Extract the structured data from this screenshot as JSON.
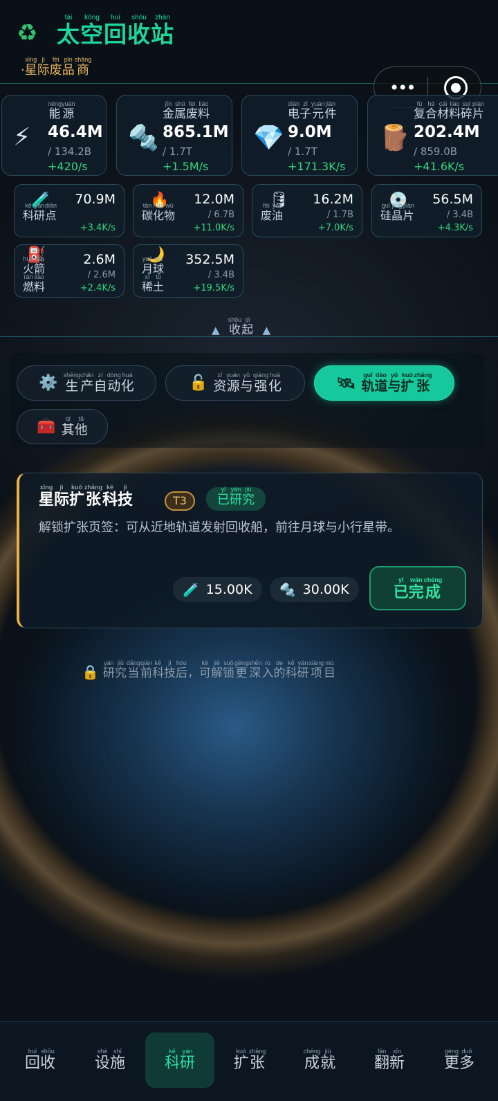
{
  "header": {
    "logo_icon": "recycle-icon",
    "title": [
      {
        "char": "太",
        "py": "tài"
      },
      {
        "char": "空",
        "py": "kōng"
      },
      {
        "char": "回",
        "py": "huí"
      },
      {
        "char": "收",
        "py": "shōu"
      },
      {
        "char": "站",
        "py": "zhàn"
      }
    ],
    "subtitle_prefix": "·",
    "subtitle": [
      {
        "char": "星",
        "py": "xīng"
      },
      {
        "char": "际",
        "py": "jì"
      },
      {
        "char": "废",
        "py": "fèi"
      },
      {
        "char": "品",
        "py": "pǐn"
      },
      {
        "char": "商",
        "py": "shāng"
      }
    ],
    "capsule_more": "•••",
    "capsule_close_icon": "target-icon"
  },
  "big_resources": [
    {
      "icon": "⚡",
      "icon_name": "lightning-icon",
      "label": [
        {
          "char": "能",
          "py": "néng"
        },
        {
          "char": "源",
          "py": "yuán"
        }
      ],
      "amount": "46.4M",
      "cap": "/ 134.2B",
      "rate": "+420/s"
    },
    {
      "icon": "🔩",
      "icon_name": "bolt-icon",
      "label": [
        {
          "char": "金",
          "py": "jīn"
        },
        {
          "char": "属",
          "py": "shǔ"
        },
        {
          "char": "废",
          "py": "fèi"
        },
        {
          "char": "料",
          "py": "liào"
        }
      ],
      "amount": "865.1M",
      "cap": "/ 1.7T",
      "rate": "+1.5M/s"
    },
    {
      "icon": "💎",
      "icon_name": "gem-icon",
      "label": [
        {
          "char": "电",
          "py": "diàn"
        },
        {
          "char": "子",
          "py": "zǐ"
        },
        {
          "char": "元",
          "py": "yuán"
        },
        {
          "char": "件",
          "py": "jiàn"
        }
      ],
      "amount": "9.0M",
      "cap": "/ 1.7T",
      "rate": "+171.3K/s"
    },
    {
      "icon": "🪵",
      "icon_name": "wood-log-icon",
      "label": [
        {
          "char": "复",
          "py": "fù"
        },
        {
          "char": "合",
          "py": "hé"
        },
        {
          "char": "材",
          "py": "cái"
        },
        {
          "char": "料",
          "py": "liào"
        },
        {
          "char": "碎",
          "py": "suì"
        },
        {
          "char": "片",
          "py": "piàn"
        }
      ],
      "amount": "202.4M",
      "cap": "/ 859.0B",
      "rate": "+41.6K/s"
    }
  ],
  "small_resources": [
    {
      "icon": "🧪",
      "icon_name": "test-tube-icon",
      "lines": [
        [
          {
            "char": "科",
            "py": "kē"
          },
          {
            "char": "研",
            "py": "yán"
          },
          {
            "char": "点",
            "py": "diǎn"
          }
        ]
      ],
      "amount": "70.9M",
      "cap": "",
      "rate": "+3.4K/s"
    },
    {
      "icon": "🔥",
      "icon_name": "fire-icon",
      "lines": [
        [
          {
            "char": "碳",
            "py": "tàn"
          },
          {
            "char": "化",
            "py": "huà"
          },
          {
            "char": "物",
            "py": "wù"
          }
        ]
      ],
      "amount": "12.0M",
      "cap": "/ 6.7B",
      "rate": "+11.0K/s"
    },
    {
      "icon": "🛢",
      "icon_name": "oil-barrel-icon",
      "lines": [
        [
          {
            "char": "废",
            "py": "fèi"
          },
          {
            "char": "油",
            "py": "yóu"
          }
        ]
      ],
      "amount": "16.2M",
      "cap": "/ 1.7B",
      "rate": "+7.0K/s"
    },
    {
      "icon": "💿",
      "icon_name": "disc-icon",
      "lines": [
        [
          {
            "char": "硅",
            "py": "guī"
          },
          {
            "char": "晶",
            "py": "jīng"
          },
          {
            "char": "片",
            "py": "piàn"
          }
        ]
      ],
      "amount": "56.5M",
      "cap": "/ 3.4B",
      "rate": "+4.3K/s"
    },
    {
      "icon": "⛽",
      "icon_name": "fuel-pump-icon",
      "lines": [
        [
          {
            "char": "火",
            "py": "huǒ"
          },
          {
            "char": "箭",
            "py": "jiàn"
          }
        ],
        [
          {
            "char": "燃",
            "py": "rán"
          },
          {
            "char": "料",
            "py": "liào"
          }
        ]
      ],
      "amount": "2.6M",
      "cap": "/ 2.6M",
      "rate": "+2.4K/s"
    },
    {
      "icon": "🌙",
      "icon_name": "moon-icon",
      "lines": [
        [
          {
            "char": "月",
            "py": "yuè"
          },
          {
            "char": "球",
            "py": "qiú"
          }
        ],
        [
          {
            "char": "稀",
            "py": "xī"
          },
          {
            "char": "土",
            "py": "tǔ"
          }
        ]
      ],
      "amount": "352.5M",
      "cap": "/ 3.4B",
      "rate": "+19.5K/s"
    }
  ],
  "collapse": {
    "triangle": "▲",
    "label": [
      {
        "char": "收",
        "py": "shōu"
      },
      {
        "char": "起",
        "py": "qǐ"
      }
    ]
  },
  "tabs": [
    {
      "icon": "⚙️",
      "icon_name": "gear-icon",
      "label": [
        {
          "char": "生",
          "py": "shēng"
        },
        {
          "char": "产",
          "py": "chǎn"
        },
        {
          "char": "自",
          "py": "zì"
        },
        {
          "char": "动",
          "py": "dòng"
        },
        {
          "char": "化",
          "py": "huà"
        }
      ],
      "active": false
    },
    {
      "icon": "🔓",
      "icon_name": "unlock-icon",
      "label": [
        {
          "char": "资",
          "py": "zī"
        },
        {
          "char": "源",
          "py": "yuán"
        },
        {
          "char": "与",
          "py": "yǔ"
        },
        {
          "char": "强",
          "py": "qiáng"
        },
        {
          "char": "化",
          "py": "huà"
        }
      ],
      "active": false
    },
    {
      "icon": "🛰",
      "icon_name": "satellite-icon",
      "label": [
        {
          "char": "轨",
          "py": "guǐ"
        },
        {
          "char": "道",
          "py": "dào"
        },
        {
          "char": "与",
          "py": "yǔ"
        },
        {
          "char": "扩",
          "py": "kuò"
        },
        {
          "char": "张",
          "py": "zhāng"
        }
      ],
      "active": true
    },
    {
      "icon": "🧰",
      "icon_name": "toolbox-icon",
      "label": [
        {
          "char": "其",
          "py": "qí"
        },
        {
          "char": "他",
          "py": "tā"
        }
      ],
      "active": false
    }
  ],
  "tech": {
    "name": [
      {
        "char": "星",
        "py": "xīng"
      },
      {
        "char": "际",
        "py": "jì"
      },
      {
        "char": "扩",
        "py": "kuò"
      },
      {
        "char": "张",
        "py": "zhāng"
      },
      {
        "char": "科",
        "py": "kē"
      },
      {
        "char": "技",
        "py": "jì"
      }
    ],
    "tier": "T3",
    "status": [
      {
        "char": "已",
        "py": "yǐ"
      },
      {
        "char": "研",
        "py": "yán"
      },
      {
        "char": "究",
        "py": "jiū"
      }
    ],
    "description": "解锁扩张页签：可从近地轨道发射回收船，前往月球与小行星带。",
    "costs": [
      {
        "icon": "🧪",
        "icon_name": "test-tube-icon",
        "amount": "15.00K"
      },
      {
        "icon": "🔩",
        "icon_name": "bolt-icon",
        "amount": "30.00K"
      }
    ],
    "button": [
      {
        "char": "已",
        "py": "yǐ"
      },
      {
        "char": "完",
        "py": "wán"
      },
      {
        "char": "成",
        "py": "chéng"
      }
    ]
  },
  "hint": {
    "icon": "🔒",
    "icon_name": "lock-icon",
    "text": [
      {
        "char": "研",
        "py": "yán"
      },
      {
        "char": "究",
        "py": "jiū"
      },
      {
        "char": "当",
        "py": "dāng"
      },
      {
        "char": "前",
        "py": "qián"
      },
      {
        "char": "科",
        "py": "kē"
      },
      {
        "char": "技",
        "py": "jì"
      },
      {
        "char": "后",
        "py": "hòu"
      },
      {
        "char": "，",
        "py": ""
      },
      {
        "char": "可",
        "py": "kě"
      },
      {
        "char": "解",
        "py": "jiě"
      },
      {
        "char": "锁",
        "py": "suǒ"
      },
      {
        "char": "更",
        "py": "gēng"
      },
      {
        "char": "深",
        "py": "shēn"
      },
      {
        "char": "入",
        "py": "rù"
      },
      {
        "char": "的",
        "py": "de"
      },
      {
        "char": "科",
        "py": "kē"
      },
      {
        "char": "研",
        "py": "yán"
      },
      {
        "char": "项",
        "py": "xiàng"
      },
      {
        "char": "目",
        "py": "mù"
      }
    ]
  },
  "nav": [
    {
      "label": [
        {
          "char": "回",
          "py": "huí"
        },
        {
          "char": "收",
          "py": "shōu"
        }
      ],
      "active": false
    },
    {
      "label": [
        {
          "char": "设",
          "py": "shè"
        },
        {
          "char": "施",
          "py": "shī"
        }
      ],
      "active": false
    },
    {
      "label": [
        {
          "char": "科",
          "py": "kē"
        },
        {
          "char": "研",
          "py": "yán"
        }
      ],
      "active": true
    },
    {
      "label": [
        {
          "char": "扩",
          "py": "kuò"
        },
        {
          "char": "张",
          "py": "zhāng"
        }
      ],
      "active": false
    },
    {
      "label": [
        {
          "char": "成",
          "py": "chéng"
        },
        {
          "char": "就",
          "py": "jiù"
        }
      ],
      "active": false
    },
    {
      "label": [
        {
          "char": "翻",
          "py": "fān"
        },
        {
          "char": "新",
          "py": "xīn"
        }
      ],
      "active": false
    },
    {
      "label": [
        {
          "char": "更",
          "py": "gèng"
        },
        {
          "char": "多",
          "py": "duō"
        }
      ],
      "active": false
    }
  ]
}
